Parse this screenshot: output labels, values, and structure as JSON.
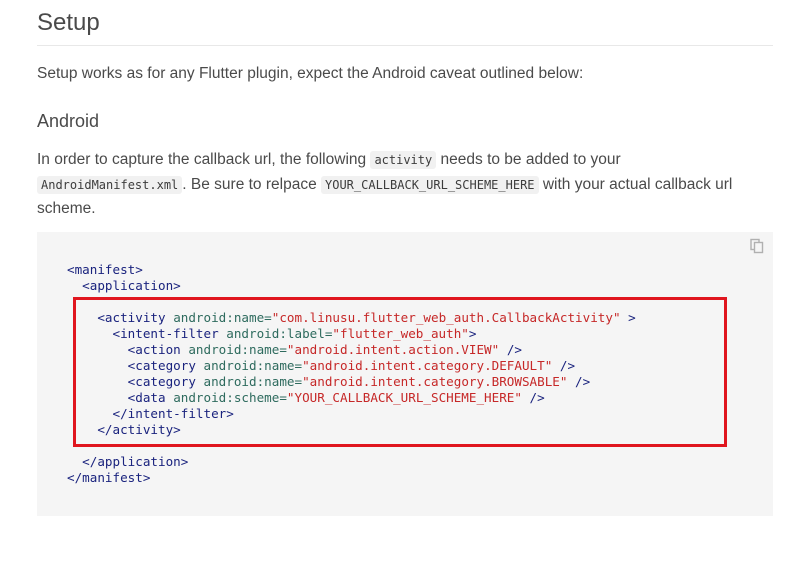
{
  "heading": "Setup",
  "intro": "Setup works as for any Flutter plugin, expect the Android caveat outlined below:",
  "subheading": "Android",
  "paragraph": {
    "t1": "In order to capture the callback url, the following ",
    "c1": "activity",
    "t2": " needs to be added to your ",
    "c2": "AndroidManifest.xml",
    "t3": ". Be sure to relpace ",
    "c3": "YOUR_CALLBACK_URL_SCHEME_HERE",
    "t4": " with your actual callback url scheme."
  },
  "code": {
    "copy_icon": "copy-icon",
    "lines": {
      "l1": "<manifest>",
      "l2": "<application>",
      "l3_tag": "<activity",
      "l3_attr": "android:name=",
      "l3_val": "\"com.linusu.flutter_web_auth.CallbackActivity\"",
      "l3_end": " >",
      "l4_tag": "<intent-filter",
      "l4_attr": "android:label=",
      "l4_val": "\"flutter_web_auth\"",
      "l4_end": ">",
      "l5_tag": "<action",
      "l5_attr": "android:name=",
      "l5_val": "\"android.intent.action.VIEW\"",
      "l5_end": " />",
      "l6_tag": "<category",
      "l6_attr": "android:name=",
      "l6_val": "\"android.intent.category.DEFAULT\"",
      "l6_end": " />",
      "l7_tag": "<category",
      "l7_attr": "android:name=",
      "l7_val": "\"android.intent.category.BROWSABLE\"",
      "l7_end": " />",
      "l8_tag": "<data",
      "l8_attr": "android:scheme=",
      "l8_val": "\"YOUR_CALLBACK_URL_SCHEME_HERE\"",
      "l8_end": " />",
      "l9": "</intent-filter>",
      "l10": "</activity>",
      "l11": "</application>",
      "l12": "</manifest>"
    }
  },
  "colors": {
    "highlight_border": "#e0161f",
    "code_background": "#f5f5f5"
  }
}
